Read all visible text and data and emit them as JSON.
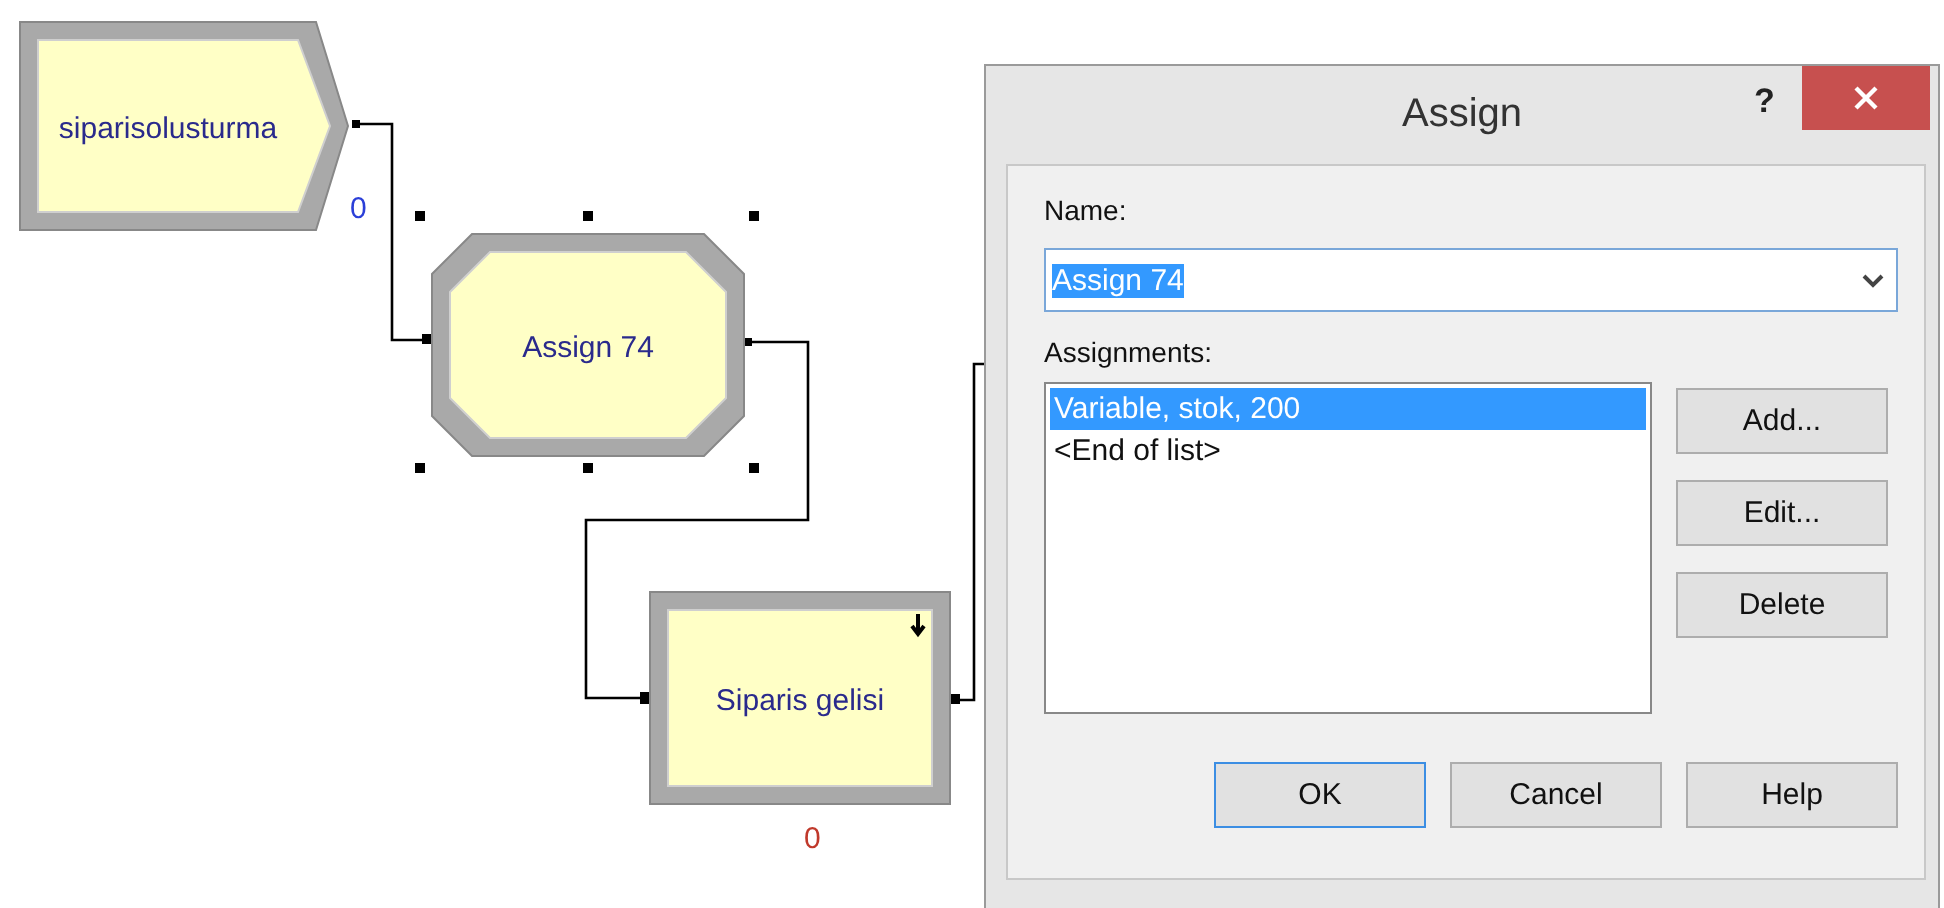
{
  "diagram": {
    "modules": [
      {
        "kind": "create",
        "label": "siparisolusturma",
        "counter": "0",
        "selected": false
      },
      {
        "kind": "assign",
        "label": "Assign 74",
        "selected": true
      },
      {
        "kind": "process",
        "label": "Siparis gelisi",
        "counter": "0",
        "selected": false
      }
    ]
  },
  "dialog": {
    "title": "Assign",
    "help": "?",
    "name_label": "Name:",
    "name_value": "Assign 74",
    "name_value_selected": true,
    "assignments_label": "Assignments:",
    "assignments": [
      {
        "text": "Variable, stok, 200",
        "selected": true
      },
      {
        "text": "<End of list>",
        "selected": false
      }
    ],
    "side_buttons": [
      "Add...",
      "Edit...",
      "Delete"
    ],
    "buttons": [
      {
        "label": "OK",
        "default": true
      },
      {
        "label": "Cancel",
        "default": false
      },
      {
        "label": "Help",
        "default": false
      }
    ]
  }
}
